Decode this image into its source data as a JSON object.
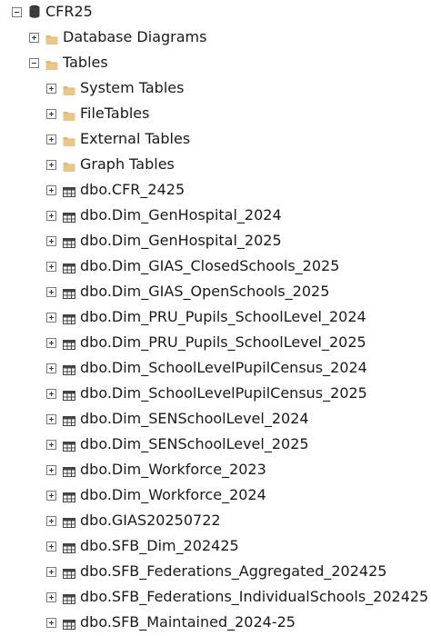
{
  "tree": {
    "root": {
      "label": "CFR25",
      "icon": "database-icon",
      "expanded": true
    },
    "folders": [
      {
        "label": "Database Diagrams",
        "icon": "folder-icon",
        "expanded": false
      },
      {
        "label": "Tables",
        "icon": "folder-icon",
        "expanded": true
      }
    ],
    "table_folders": [
      {
        "label": "System Tables",
        "icon": "folder-icon",
        "expanded": false
      },
      {
        "label": "FileTables",
        "icon": "folder-icon",
        "expanded": false
      },
      {
        "label": "External Tables",
        "icon": "folder-icon",
        "expanded": false
      },
      {
        "label": "Graph Tables",
        "icon": "folder-icon",
        "expanded": false
      }
    ],
    "tables": [
      {
        "label": "dbo.CFR_2425",
        "icon": "table-icon"
      },
      {
        "label": "dbo.Dim_GenHospital_2024",
        "icon": "table-icon"
      },
      {
        "label": "dbo.Dim_GenHospital_2025",
        "icon": "table-icon"
      },
      {
        "label": "dbo.Dim_GIAS_ClosedSchools_2025",
        "icon": "table-icon"
      },
      {
        "label": "dbo.Dim_GIAS_OpenSchools_2025",
        "icon": "table-icon"
      },
      {
        "label": "dbo.Dim_PRU_Pupils_SchoolLevel_2024",
        "icon": "table-icon"
      },
      {
        "label": "dbo.Dim_PRU_Pupils_SchoolLevel_2025",
        "icon": "table-icon"
      },
      {
        "label": "dbo.Dim_SchoolLevelPupilCensus_2024",
        "icon": "table-icon"
      },
      {
        "label": "dbo.Dim_SchoolLevelPupilCensus_2025",
        "icon": "table-icon"
      },
      {
        "label": "dbo.Dim_SENSchoolLevel_2024",
        "icon": "table-icon"
      },
      {
        "label": "dbo.Dim_SENSchoolLevel_2025",
        "icon": "table-icon"
      },
      {
        "label": "dbo.Dim_Workforce_2023",
        "icon": "table-icon"
      },
      {
        "label": "dbo.Dim_Workforce_2024",
        "icon": "table-icon"
      },
      {
        "label": "dbo.GIAS20250722",
        "icon": "table-icon"
      },
      {
        "label": "dbo.SFB_Dim_202425",
        "icon": "table-icon"
      },
      {
        "label": "dbo.SFB_Federations_Aggregated_202425",
        "icon": "table-icon"
      },
      {
        "label": "dbo.SFB_Federations_IndividualSchools_202425",
        "icon": "table-icon"
      },
      {
        "label": "dbo.SFB_Maintained_2024-25",
        "icon": "table-icon"
      }
    ]
  },
  "colors": {
    "folder": "#dcb67a",
    "folder_dark": "#c9a15a",
    "database": "#3a3a3a",
    "table_grid": "#444444",
    "expander_border": "#7a7a7a",
    "text": "#1a1a1a"
  }
}
